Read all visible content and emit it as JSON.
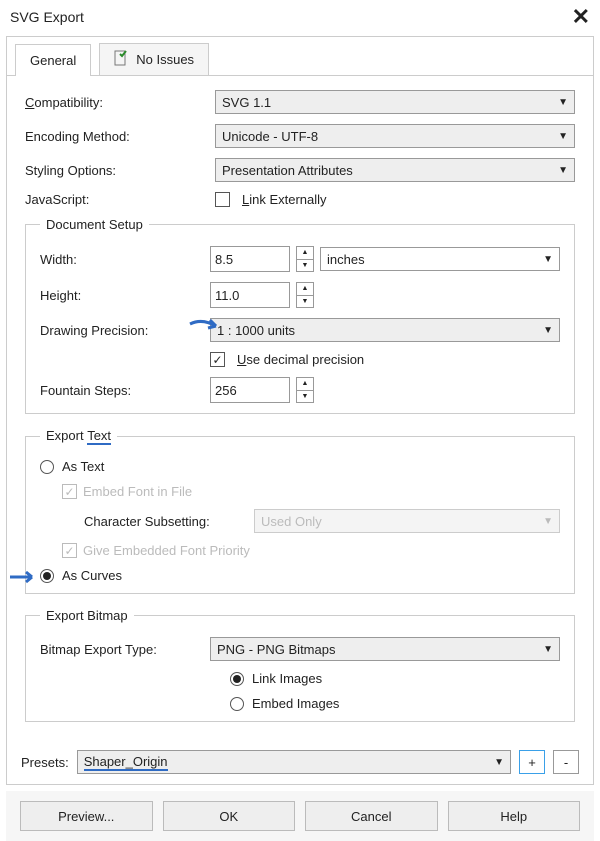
{
  "window": {
    "title": "SVG Export",
    "close_label": "✕"
  },
  "tabs": {
    "general": "General",
    "noissues": "No Issues"
  },
  "general": {
    "compat_label": "Compatibility:",
    "compat_value": "SVG 1.1",
    "encoding_label": "Encoding Method:",
    "encoding_value": "Unicode - UTF-8",
    "styling_label": "Styling Options:",
    "styling_value": "Presentation Attributes",
    "js_label": "JavaScript:",
    "js_link_label": "Link Externally"
  },
  "docsetup": {
    "legend": "Document Setup",
    "width_label": "Width:",
    "width_value": "8.5",
    "units_value": "inches",
    "height_label": "Height:",
    "height_value": "11.0",
    "precision_label": "Drawing Precision:",
    "precision_value": "1 : 1000 units",
    "decimal_label": "Use decimal precision",
    "fountain_label": "Fountain Steps:",
    "fountain_value": "256"
  },
  "exporttext": {
    "legend": "Export Text",
    "as_text": "As Text",
    "embed_font": "Embed Font in File",
    "charsub_label": "Character Subsetting:",
    "charsub_value": "Used Only",
    "give_priority": "Give Embedded Font Priority",
    "as_curves": "As Curves"
  },
  "exportbmp": {
    "legend": "Export Bitmap",
    "type_label": "Bitmap Export Type:",
    "type_value": "PNG - PNG Bitmaps",
    "link": "Link Images",
    "embed": "Embed Images"
  },
  "presets": {
    "label": "Presets:",
    "value": "Shaper_Origin",
    "plus": "+",
    "minus": "-"
  },
  "buttons": {
    "preview": "Preview...",
    "ok": "OK",
    "cancel": "Cancel",
    "help": "Help"
  }
}
